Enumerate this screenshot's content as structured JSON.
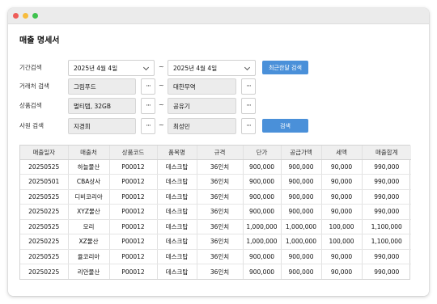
{
  "window": {
    "controls": [
      {
        "name": "close",
        "color": "#ee5c58"
      },
      {
        "name": "minimize",
        "color": "#f7bc3d"
      },
      {
        "name": "maximize",
        "color": "#3ec24d"
      }
    ]
  },
  "page_title": "매출 명세서",
  "form": {
    "period": {
      "label": "기간검색",
      "from": "2025년 4월 4일",
      "to": "2025년 4월 4일",
      "recent_button": "최근한달 검색"
    },
    "client": {
      "label": "거래처 검색",
      "from": "그림푸드",
      "to": "대한무역"
    },
    "product": {
      "label": "상품검색",
      "from": "멀티탭, 32GB",
      "to": "공유기"
    },
    "employee": {
      "label": "사원 검색",
      "from": "지경희",
      "to": "최성민",
      "search_button": "검색"
    },
    "tilde": "~",
    "dots": "···"
  },
  "table": {
    "headers": [
      "매출일자",
      "매출처",
      "상품코드",
      "품목명",
      "규격",
      "단가",
      "공급가액",
      "세액",
      "매출합계"
    ],
    "rows": [
      [
        "20250525",
        "하늘물산",
        "P00012",
        "데스크탑",
        "36인치",
        "900,000",
        "900,000",
        "90,000",
        "990,000"
      ],
      [
        "20250501",
        "CBA상사",
        "P00012",
        "데스크탑",
        "36인치",
        "900,000",
        "900,000",
        "90,000",
        "990,000"
      ],
      [
        "20250525",
        "디비코리아",
        "P00012",
        "데스크탑",
        "36인치",
        "900,000",
        "900,000",
        "90,000",
        "990,000"
      ],
      [
        "20250225",
        "XYZ물산",
        "P00012",
        "데스크탑",
        "36인치",
        "900,000",
        "900,000",
        "90,000",
        "990,000"
      ],
      [
        "20250525",
        "모리",
        "P00012",
        "데스크탑",
        "36인치",
        "1,000,000",
        "1,000,000",
        "100,000",
        "1,100,000"
      ],
      [
        "20250225",
        "XZ물산",
        "P00012",
        "데스크탑",
        "36인치",
        "1,000,000",
        "1,000,000",
        "100,000",
        "1,100,000"
      ],
      [
        "20250525",
        "율코리아",
        "P00012",
        "데스크탑",
        "36인치",
        "900,000",
        "900,000",
        "90,000",
        "990,000"
      ],
      [
        "20250225",
        "리안물산",
        "P00012",
        "데스크탑",
        "36인치",
        "900,000",
        "900,000",
        "90,000",
        "990,000"
      ]
    ]
  }
}
